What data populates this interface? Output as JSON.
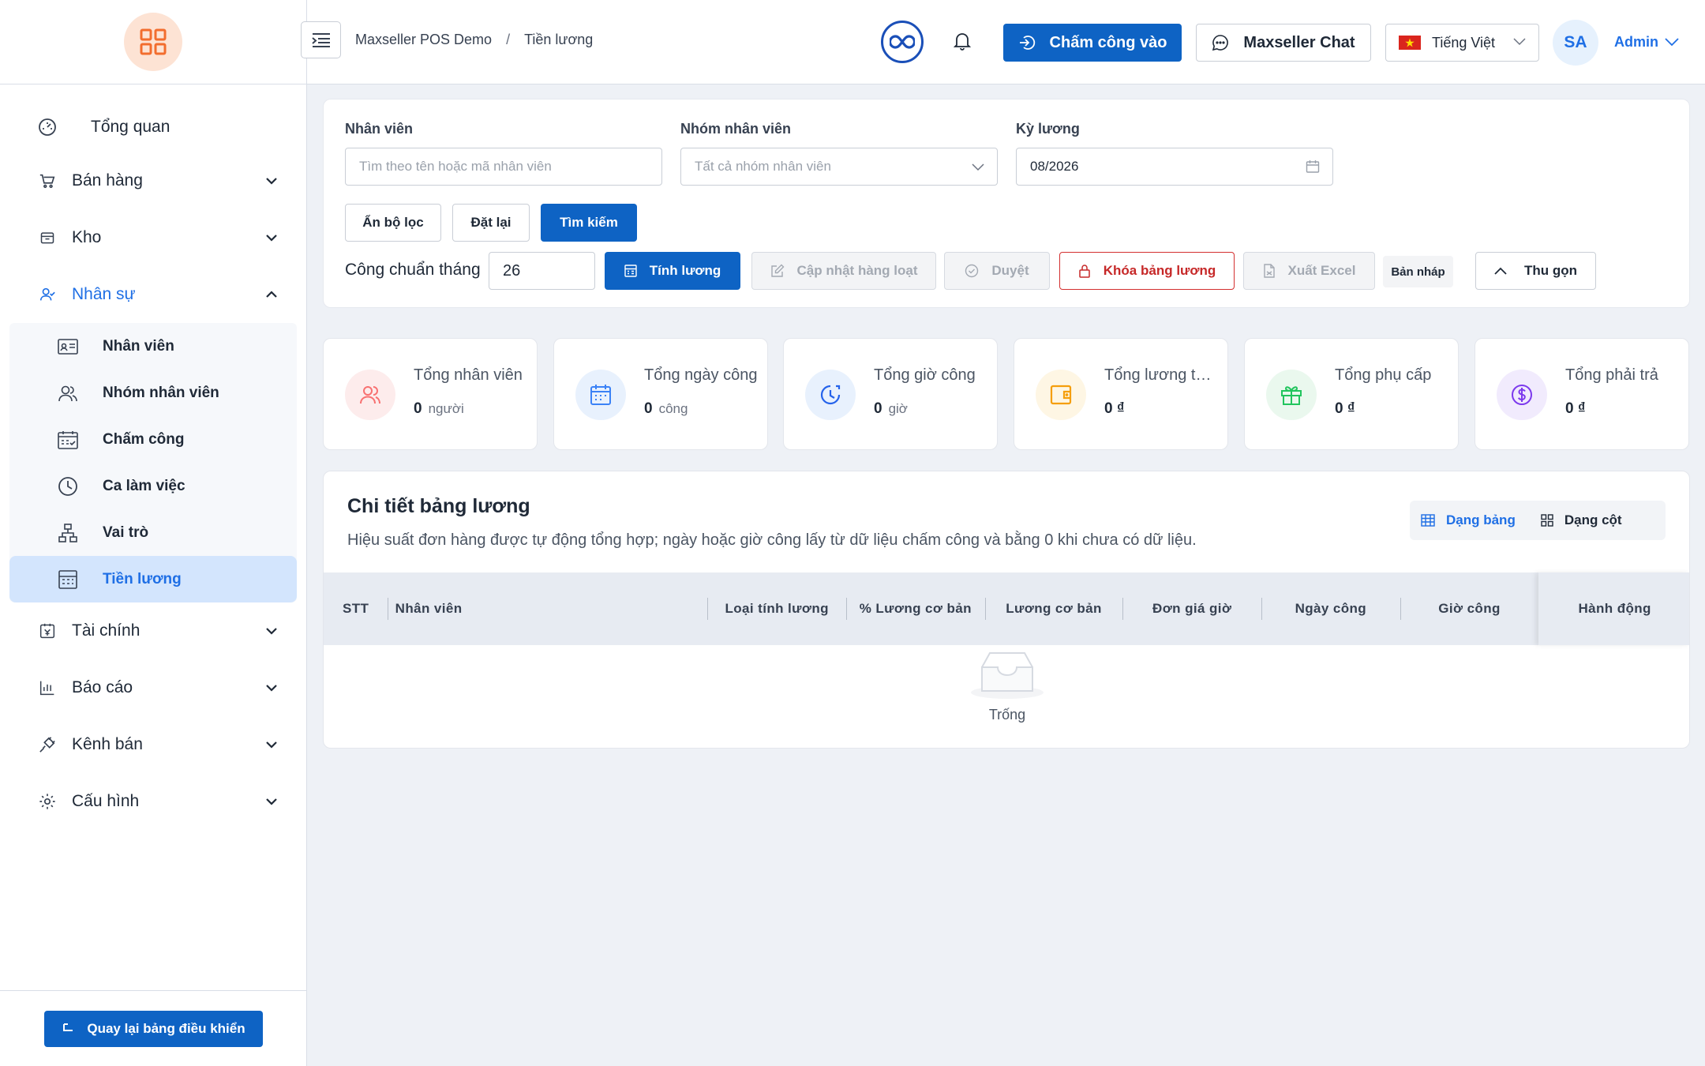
{
  "sidebar": {
    "items": [
      {
        "label": "Tổng quan"
      },
      {
        "label": "Bán hàng"
      },
      {
        "label": "Kho"
      },
      {
        "label": "Nhân sự"
      },
      {
        "label": "Tài chính"
      },
      {
        "label": "Báo cáo"
      },
      {
        "label": "Kênh bán"
      },
      {
        "label": "Cấu hình"
      }
    ],
    "sub_items": [
      {
        "label": "Nhân viên"
      },
      {
        "label": "Nhóm nhân viên"
      },
      {
        "label": "Chấm công"
      },
      {
        "label": "Ca làm việc"
      },
      {
        "label": "Vai trò"
      },
      {
        "label": "Tiền lương"
      }
    ],
    "footer_button": "Quay lại bảng điều khiển"
  },
  "header": {
    "breadcrumb": [
      "Maxseller POS Demo",
      "/",
      "Tiền lương"
    ],
    "checkin_label": "Chấm công vào",
    "chat_label": "Maxseller Chat",
    "language": "Tiếng Việt",
    "avatar_initials": "SA",
    "user_name": "Admin"
  },
  "filter": {
    "employee_label": "Nhân viên",
    "employee_placeholder": "Tìm theo tên hoặc mã nhân viên",
    "group_label": "Nhóm nhân viên",
    "group_placeholder": "Tất cả nhóm nhân viên",
    "period_label": "Kỳ lương",
    "period_value": "08/2026",
    "hide_filter": "Ẩn bộ lọc",
    "reset": "Đặt lại",
    "search": "Tìm kiếm",
    "standard_days_label": "Công chuẩn tháng",
    "standard_days_value": "26",
    "calc_salary": "Tính lương",
    "bulk_update": "Cập nhật hàng loạt",
    "approve": "Duyệt",
    "lock_payroll": "Khóa bảng lương",
    "export_excel": "Xuất Excel",
    "draft_badge": "Bản nháp",
    "collapse": "Thu gọn"
  },
  "cards": [
    {
      "title": "Tổng nhân viên",
      "value": "0",
      "unit": "người",
      "color": "#f87171",
      "bg": "#fdecec",
      "icon": "users-icon"
    },
    {
      "title": "Tổng ngày công",
      "value": "0",
      "unit": "công",
      "color": "#3b82f6",
      "bg": "#e8f1fd",
      "icon": "calendar-icon"
    },
    {
      "title": "Tổng giờ công",
      "value": "0",
      "unit": "giờ",
      "color": "#2563eb",
      "bg": "#e8f1fd",
      "icon": "clock-icon"
    },
    {
      "title": "Tổng lương theo đơn",
      "value": "0 ₫",
      "unit": "",
      "color": "#f59e0b",
      "bg": "#fef6e4",
      "icon": "wallet-icon"
    },
    {
      "title": "Tổng phụ cấp",
      "value": "0 ₫",
      "unit": "",
      "color": "#22c55e",
      "bg": "#eaf8ee",
      "icon": "gift-icon"
    },
    {
      "title": "Tổng phải trả",
      "value": "0 ₫",
      "unit": "",
      "color": "#7c3aed",
      "bg": "#f1ebfd",
      "icon": "dollar-icon"
    }
  ],
  "detail": {
    "title": "Chi tiết bảng lương",
    "subtitle": "Hiệu suất đơn hàng được tự động tổng hợp; ngày hoặc giờ công lấy từ dữ liệu chấm công và bằng 0 khi chưa có dữ liệu.",
    "view_table": "Dạng bảng",
    "view_column": "Dạng cột",
    "columns": [
      "STT",
      "Nhân viên",
      "Loại tính lương",
      "% Lương cơ bản",
      "Lương cơ bản",
      "Đơn giá giờ",
      "Ngày công",
      "Giờ công",
      "Hành động"
    ],
    "empty_text": "Trống"
  },
  "colors": {
    "primary": "#0e63c4",
    "accent": "#1f6fe5",
    "danger": "#c62828"
  }
}
